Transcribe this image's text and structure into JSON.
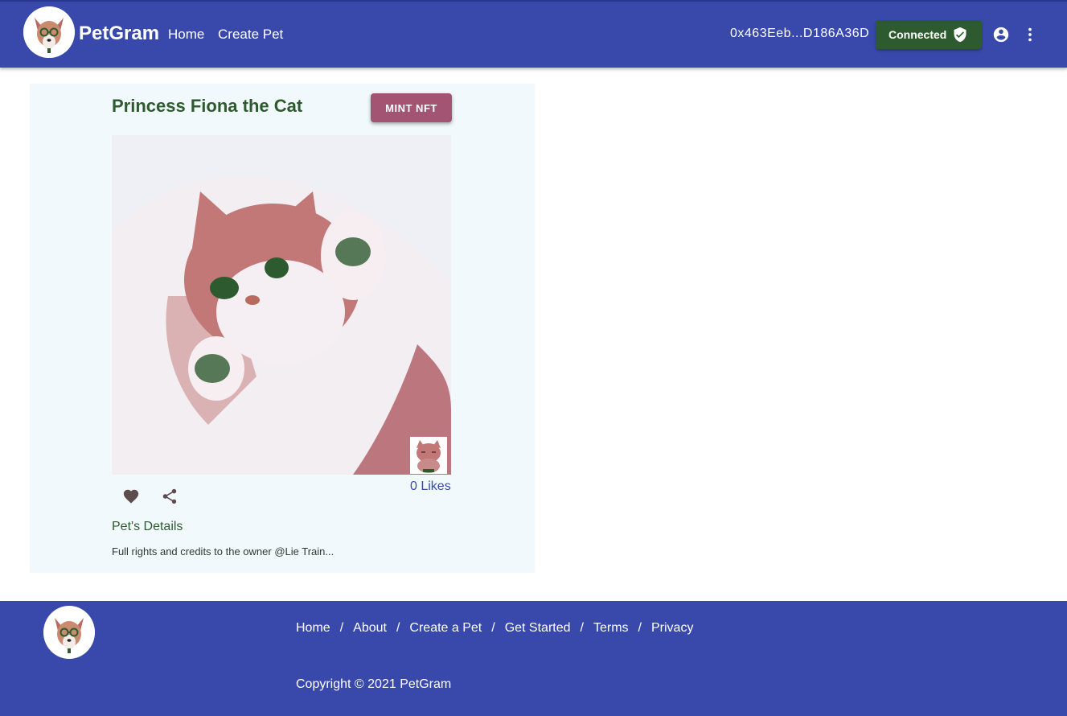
{
  "header": {
    "brand": "PetGram",
    "nav": [
      {
        "label": "Home"
      },
      {
        "label": "Create Pet"
      }
    ],
    "wallet_address": "0x463Eeb...D186A36D",
    "connected_label": "Connected",
    "icons": [
      "shield-check-icon",
      "account-circle-icon",
      "more-vert-icon"
    ]
  },
  "pet": {
    "name": "Princess Fiona the Cat",
    "mint_label": "MINT NFT",
    "likes": "0 Likes",
    "details_title": "Pet's Details",
    "description": "Full rights and credits to the owner @Lie Train..."
  },
  "footer": {
    "links": [
      {
        "label": "Home"
      },
      {
        "label": "About"
      },
      {
        "label": "Create a Pet"
      },
      {
        "label": "Get Started"
      },
      {
        "label": "Terms"
      },
      {
        "label": "Privacy"
      }
    ],
    "separator": "/",
    "copyright": "Copyright © 2021 PetGram"
  },
  "colors": {
    "primary": "#3949ab",
    "success": "#2e5a2f",
    "mint": "#a35472",
    "card_bg": "#f1f9fc"
  }
}
